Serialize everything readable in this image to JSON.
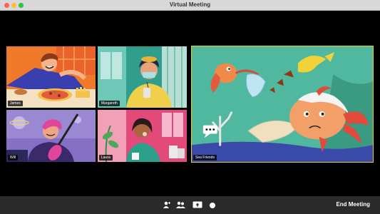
{
  "window": {
    "title": "Virtual Meeting"
  },
  "participants": [
    {
      "name": "James",
      "icon": "pizza-scene"
    },
    {
      "name": "Margareth",
      "icon": "mask-drink-scene"
    },
    {
      "name": "Will",
      "icon": "guitar-scene"
    },
    {
      "name": "Laura",
      "icon": "cough-scene"
    }
  ],
  "featured": {
    "name": "Sea Friends",
    "icon": "fish-mask-scene"
  },
  "toolbar": {
    "buttons": [
      "add-participant-icon",
      "participants-icon",
      "share-screen-icon",
      "record-icon"
    ],
    "end_label": "End Meeting"
  },
  "colors": {
    "accent_border": "#e8c84a",
    "toolbar_bg": "#2b2b2b",
    "titlebar_bg": "#d8d8d8"
  }
}
